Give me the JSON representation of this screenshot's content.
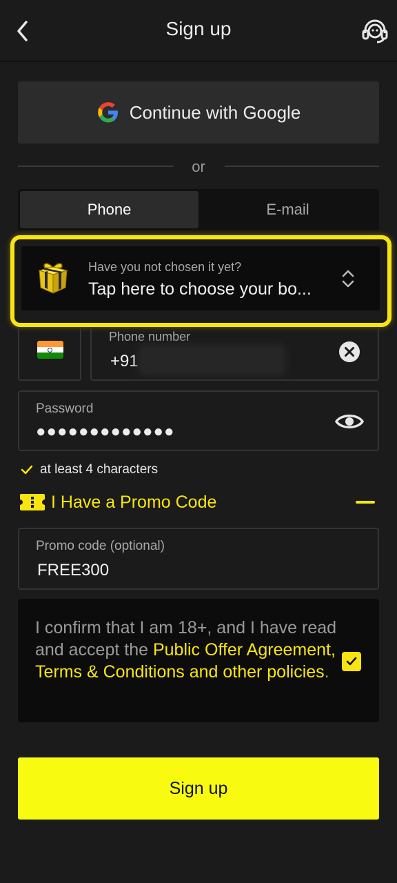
{
  "header": {
    "title": "Sign up",
    "back_icon": "chevron-left-icon",
    "support_icon": "headset-icon"
  },
  "google_button": {
    "label": "Continue with Google",
    "icon": "google-icon"
  },
  "divider": {
    "label": "or"
  },
  "tabs": [
    {
      "label": "Phone",
      "active": true
    },
    {
      "label": "E-mail",
      "active": false
    }
  ],
  "bonus": {
    "hint": "Have you not chosen it yet?",
    "value": "Tap here to choose your bo...",
    "icon": "gift-icon",
    "chevron_icon": "chevron-up-down-icon"
  },
  "phone": {
    "country_flag": "india-flag",
    "label": "Phone number",
    "prefix": "+91",
    "clear_icon": "clear-icon"
  },
  "password": {
    "label": "Password",
    "value": "●●●●●●●●●●●●●",
    "toggle_icon": "eye-icon"
  },
  "password_rule": {
    "text": "at least 4 characters",
    "icon": "check-icon"
  },
  "promo_toggle": {
    "label": "I Have a Promo Code",
    "icon": "ticket-icon",
    "collapse_icon": "minus-icon"
  },
  "promo_field": {
    "label": "Promo code (optional)",
    "value": "FREE300"
  },
  "consent": {
    "text_before": "I confirm that I am 18+, and I have read and accept the ",
    "link_public_offer": "Public Offer Agreement",
    "separator": ", ",
    "link_terms": "Terms & Conditions and other policies",
    "text_after": ".",
    "checked": true
  },
  "signup_button": {
    "label": "Sign up"
  },
  "colors": {
    "accent": "#f8e50f",
    "button": "#f8fb10",
    "background": "#1b1b1b"
  }
}
